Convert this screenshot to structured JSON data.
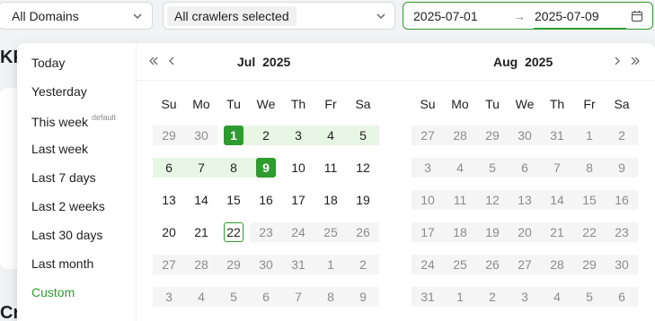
{
  "filters": {
    "domains": "All Domains",
    "crawlers": "All crawlers selected"
  },
  "range": {
    "start": "2025-07-01",
    "arrow": "→",
    "end": "2025-07-09"
  },
  "background": {
    "kpi_fragment": "KP",
    "cr_fragment": "Cr"
  },
  "presets": [
    {
      "label": "Today"
    },
    {
      "label": "Yesterday"
    },
    {
      "label": "This week",
      "badge": "default"
    },
    {
      "label": "Last week"
    },
    {
      "label": "Last 7 days"
    },
    {
      "label": "Last 2 weeks"
    },
    {
      "label": "Last 30 days"
    },
    {
      "label": "Last month"
    },
    {
      "label": "Custom",
      "active": true
    }
  ],
  "weekdays": [
    "Su",
    "Mo",
    "Tu",
    "We",
    "Th",
    "Fr",
    "Sa"
  ],
  "months": [
    {
      "title": "Jul  2025",
      "weeks": [
        [
          [
            "29",
            "out"
          ],
          [
            "30",
            "out"
          ],
          [
            "1",
            "sel"
          ],
          [
            "2",
            "inrange"
          ],
          [
            "3",
            "inrange"
          ],
          [
            "4",
            "inrange"
          ],
          [
            "5",
            "inrange"
          ]
        ],
        [
          [
            "6",
            "inrange"
          ],
          [
            "7",
            "inrange"
          ],
          [
            "8",
            "inrange"
          ],
          [
            "9",
            "sel"
          ],
          [
            "10",
            "cur"
          ],
          [
            "11",
            "cur"
          ],
          [
            "12",
            "cur"
          ]
        ],
        [
          [
            "13",
            "cur"
          ],
          [
            "14",
            "cur"
          ],
          [
            "15",
            "cur"
          ],
          [
            "16",
            "cur"
          ],
          [
            "17",
            "cur"
          ],
          [
            "18",
            "cur"
          ],
          [
            "19",
            "cur"
          ]
        ],
        [
          [
            "20",
            "cur"
          ],
          [
            "21",
            "cur"
          ],
          [
            "22",
            "today"
          ],
          [
            "23",
            "out"
          ],
          [
            "24",
            "out"
          ],
          [
            "25",
            "out"
          ],
          [
            "26",
            "out"
          ]
        ],
        [
          [
            "27",
            "out"
          ],
          [
            "28",
            "out"
          ],
          [
            "29",
            "out"
          ],
          [
            "30",
            "out"
          ],
          [
            "31",
            "out"
          ],
          [
            "1",
            "out"
          ],
          [
            "2",
            "out"
          ]
        ],
        [
          [
            "3",
            "out"
          ],
          [
            "4",
            "out"
          ],
          [
            "5",
            "out"
          ],
          [
            "6",
            "out"
          ],
          [
            "7",
            "out"
          ],
          [
            "8",
            "out"
          ],
          [
            "9",
            "out"
          ]
        ]
      ]
    },
    {
      "title": "Aug  2025",
      "weeks": [
        [
          [
            "27",
            "out"
          ],
          [
            "28",
            "out"
          ],
          [
            "29",
            "out"
          ],
          [
            "30",
            "out"
          ],
          [
            "31",
            "out"
          ],
          [
            "1",
            "out"
          ],
          [
            "2",
            "out"
          ]
        ],
        [
          [
            "3",
            "out"
          ],
          [
            "4",
            "out"
          ],
          [
            "5",
            "out"
          ],
          [
            "6",
            "out"
          ],
          [
            "7",
            "out"
          ],
          [
            "8",
            "out"
          ],
          [
            "9",
            "out"
          ]
        ],
        [
          [
            "10",
            "out"
          ],
          [
            "11",
            "out"
          ],
          [
            "12",
            "out"
          ],
          [
            "13",
            "out"
          ],
          [
            "14",
            "out"
          ],
          [
            "15",
            "out"
          ],
          [
            "16",
            "out"
          ]
        ],
        [
          [
            "17",
            "out"
          ],
          [
            "18",
            "out"
          ],
          [
            "19",
            "out"
          ],
          [
            "20",
            "out"
          ],
          [
            "21",
            "out"
          ],
          [
            "22",
            "out"
          ],
          [
            "23",
            "out"
          ]
        ],
        [
          [
            "24",
            "out"
          ],
          [
            "25",
            "out"
          ],
          [
            "26",
            "out"
          ],
          [
            "27",
            "out"
          ],
          [
            "28",
            "out"
          ],
          [
            "29",
            "out"
          ],
          [
            "30",
            "out"
          ]
        ],
        [
          [
            "31",
            "out"
          ],
          [
            "1",
            "out"
          ],
          [
            "2",
            "out"
          ],
          [
            "3",
            "out"
          ],
          [
            "4",
            "out"
          ],
          [
            "5",
            "out"
          ],
          [
            "6",
            "out"
          ]
        ]
      ]
    }
  ],
  "colors": {
    "accent": "#2e9b2e",
    "range_bg": "#e8f6e6",
    "disabled_bg": "#f5f5f5"
  }
}
